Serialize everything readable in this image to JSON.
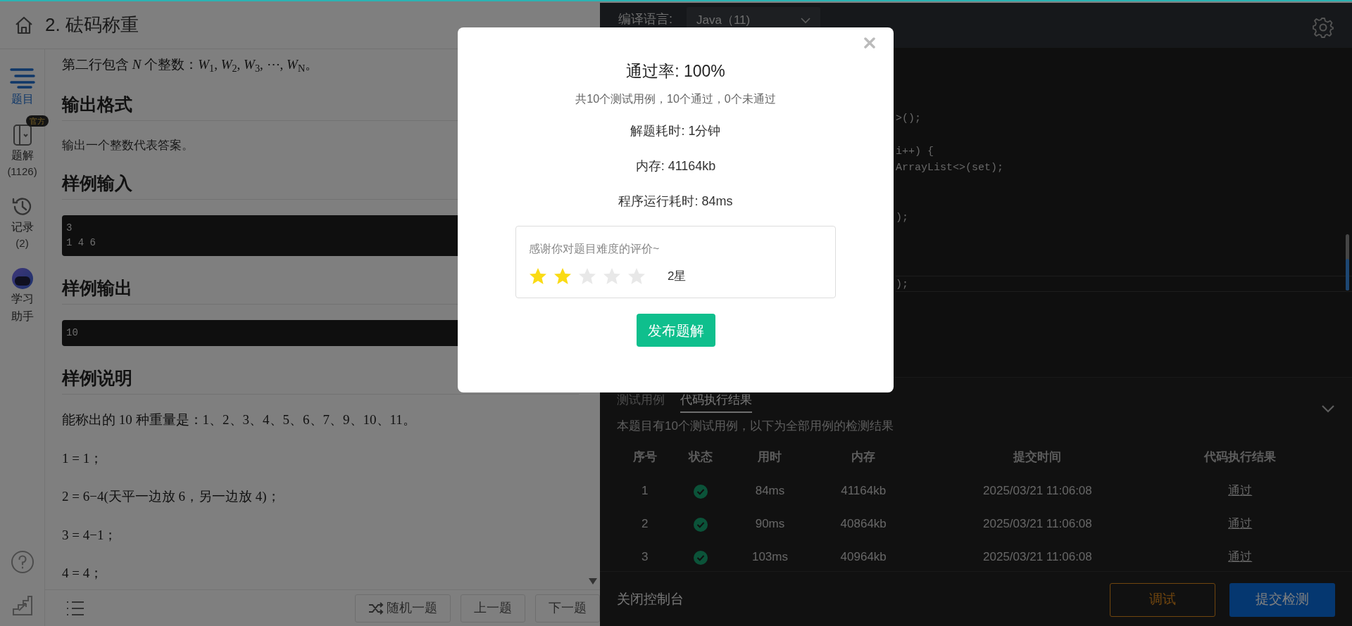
{
  "header": {
    "title": "2. 砝码称重"
  },
  "sidebar": {
    "items": [
      {
        "kind": "list",
        "label": "题目",
        "selected": true
      },
      {
        "kind": "book",
        "label": "题解",
        "count": "(1126)",
        "badge": "官方",
        "selected": false
      },
      {
        "kind": "history",
        "label": "记录",
        "count": "(2)",
        "selected": false
      },
      {
        "kind": "bot",
        "label": "学习助手",
        "selected": false
      }
    ]
  },
  "problem": {
    "blocks": [
      {
        "kind": "math",
        "text": "第二行包含 *N* 个整数：*W*$_{1}$, *W*$_{2}$, *W*$_{3}$, ⋯, *W*$_{N}$。"
      },
      {
        "kind": "heading",
        "text": "输出格式"
      },
      {
        "kind": "text",
        "text": "输出一个整数代表答案。"
      },
      {
        "kind": "heading",
        "text": "样例输入"
      },
      {
        "kind": "code",
        "lines": [
          "3",
          "1 4 6"
        ]
      },
      {
        "kind": "heading",
        "text": "样例输出"
      },
      {
        "kind": "code",
        "lines": [
          "10"
        ]
      },
      {
        "kind": "heading",
        "text": "样例说明"
      },
      {
        "kind": "math",
        "text": "能称出的 10 种重量是：1、2、3、4、5、6、7、9、10、11。"
      },
      {
        "kind": "math",
        "text": "1 = 1；"
      },
      {
        "kind": "math",
        "text": "2 = 6−4(天平一边放 6，另一边放 4)；"
      },
      {
        "kind": "math",
        "text": "3 = 4−1；"
      },
      {
        "kind": "math",
        "text": "4 = 4；"
      }
    ]
  },
  "bottom_bar": {
    "buttons": [
      {
        "kind": "random",
        "label": "随机一题"
      },
      {
        "kind": "plain",
        "label": "上一题"
      },
      {
        "kind": "plain",
        "label": "下一题"
      }
    ]
  },
  "editor": {
    "language_label": "编译语言:",
    "language": "Java（11)",
    "code_lines": [
      {
        "text": ">();",
        "current": false
      },
      {
        "text": "i++) {",
        "current": false
      },
      {
        "text": "ArrayList<>(set);",
        "current": false
      },
      {
        "text": ");",
        "current": false
      },
      {
        "text": ");",
        "current": true
      }
    ]
  },
  "console": {
    "tabs": [
      {
        "label": "测试用例",
        "selected": false
      },
      {
        "label": "代码执行结果",
        "selected": true
      }
    ],
    "summary": "本题目有10个测试用例，以下为全部用例的检测结果",
    "columns": [
      "序号",
      "状态",
      "用时",
      "内存",
      "提交时间",
      "代码执行结果"
    ],
    "rows": [
      {
        "index": "1",
        "passed": true,
        "time": "84ms",
        "memory": "41164kb",
        "submitted": "2025/03/21 11:06:08",
        "result": "通过"
      },
      {
        "index": "2",
        "passed": true,
        "time": "90ms",
        "memory": "40864kb",
        "submitted": "2025/03/21 11:06:08",
        "result": "通过"
      },
      {
        "index": "3",
        "passed": true,
        "time": "103ms",
        "memory": "40964kb",
        "submitted": "2025/03/21 11:06:08",
        "result": "通过"
      }
    ],
    "close_label": "关闭控制台",
    "buttons": [
      {
        "kind": "outline",
        "label": "调试"
      },
      {
        "kind": "primary",
        "label": "提交检测"
      }
    ]
  },
  "modal": {
    "title": "通过率: 100%",
    "summary": "共10个测试用例，10个通过，0个未通过",
    "stats": [
      "解题耗时: 1分钟",
      "内存: 41164kb",
      "程序运行耗时: 84ms"
    ],
    "rating": {
      "prompt": "感谢你对题目难度的评价~",
      "stars": 2,
      "label": "2星"
    },
    "button": "发布题解"
  }
}
